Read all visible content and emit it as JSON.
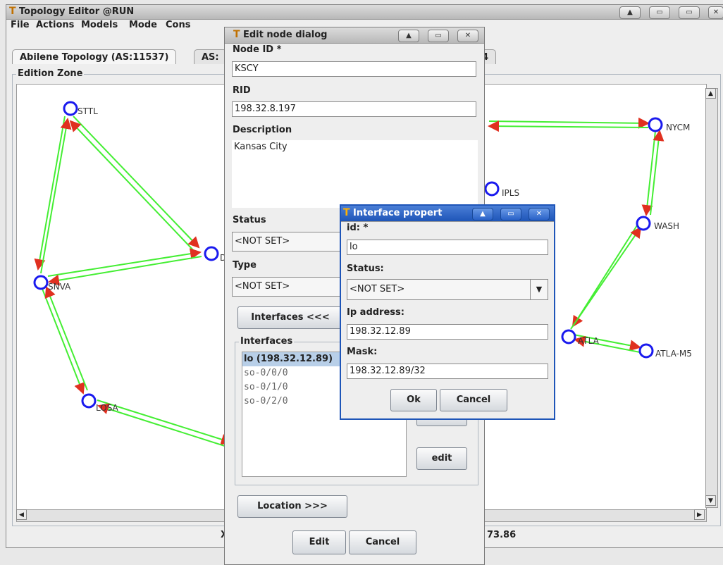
{
  "main_window": {
    "title": "Topology Editor @RUN",
    "menu": [
      "File",
      "Actions",
      "Models",
      "Mode",
      "Cons"
    ],
    "tabs": [
      {
        "label": "Abilene Topology (AS:11537)"
      },
      {
        "label": "AS:"
      },
      {
        "label": "4"
      }
    ],
    "edition_zone_label": "Edition Zone",
    "status_partial": {
      "left": "X",
      "right": "73.86"
    }
  },
  "topology": {
    "nodes": [
      {
        "id": "STTL",
        "label": "STTL"
      },
      {
        "id": "SNVA",
        "label": "SNVA"
      },
      {
        "id": "LOSA",
        "label": "LOSA"
      },
      {
        "id": "D",
        "label": "D"
      },
      {
        "id": "NYCM",
        "label": "NYCM"
      },
      {
        "id": "IPLS",
        "label": "IPLS"
      },
      {
        "id": "WASH",
        "label": "WASH"
      },
      {
        "id": "ATLA",
        "label": "ATLA"
      },
      {
        "id": "ATLA-M5",
        "label": "ATLA-M5"
      }
    ],
    "colors": {
      "link": "#44ee33",
      "arrow": "#e03020",
      "node": "#1a1aee"
    }
  },
  "edit_node_dialog": {
    "title": "Edit node dialog",
    "node_id_label": "Node ID *",
    "node_id_value": "KSCY",
    "rid_label": "RID",
    "rid_value": "198.32.8.197",
    "description_label": "Description",
    "description_value": "Kansas City",
    "status_label": "Status",
    "status_value": "<NOT SET>",
    "type_label": "Type",
    "type_value": "<NOT SET>",
    "interfaces_toggle": "Interfaces <<<",
    "interfaces_group_label": "Interfaces",
    "interfaces": [
      {
        "label": "lo (198.32.12.89)",
        "selected": true
      },
      {
        "label": "so-0/0/0",
        "selected": false
      },
      {
        "label": "so-0/1/0",
        "selected": false
      },
      {
        "label": "so-0/2/0",
        "selected": false
      }
    ],
    "edit_button": "edit",
    "location_button": "Location >>>",
    "ok_button": "Edit",
    "cancel_button": "Cancel"
  },
  "interface_dialog": {
    "title": "Interface propert",
    "id_label": "id: *",
    "id_value": "lo",
    "status_label": "Status:",
    "status_value": "<NOT SET>",
    "ip_label": "Ip address:",
    "ip_value": "198.32.12.89",
    "mask_label": "Mask:",
    "mask_value": "198.32.12.89/32",
    "ok_button": "Ok",
    "cancel_button": "Cancel"
  }
}
